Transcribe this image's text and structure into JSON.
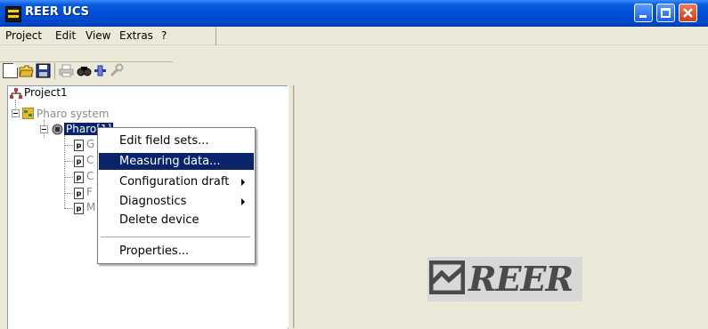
{
  "window": {
    "title": "REER UCS"
  },
  "menubar": {
    "items": [
      "Project",
      "Edit",
      "View",
      "Extras",
      "?"
    ]
  },
  "toolbar": {
    "buttons": [
      "new-document-icon",
      "open-folder-icon",
      "save-icon",
      "print-icon",
      "find-icon",
      "connect-icon",
      "wrench-icon"
    ]
  },
  "tree": {
    "root": {
      "label": "Project1"
    },
    "system": {
      "label": "Pharo system"
    },
    "device": {
      "label": "Pharo[1]"
    },
    "children_initials": [
      "G",
      "C",
      "C",
      "F",
      "M"
    ]
  },
  "context_menu": {
    "items": [
      {
        "label": "Edit field sets...",
        "submenu": false,
        "selected": false
      },
      {
        "label": "Measuring data...",
        "submenu": false,
        "selected": true
      },
      {
        "label": "Configuration draft",
        "submenu": true,
        "selected": false
      },
      {
        "label": "Diagnostics",
        "submenu": true,
        "selected": false
      },
      {
        "label": "Delete device",
        "submenu": false,
        "selected": false
      },
      {
        "label": "Properties...",
        "submenu": false,
        "selected": false
      }
    ]
  },
  "logo": {
    "text": "REER",
    "color": "#4a4a4a"
  },
  "colors": {
    "titlebar": "#0050d8",
    "selection": "#0a246a",
    "face": "#ece9d8"
  }
}
